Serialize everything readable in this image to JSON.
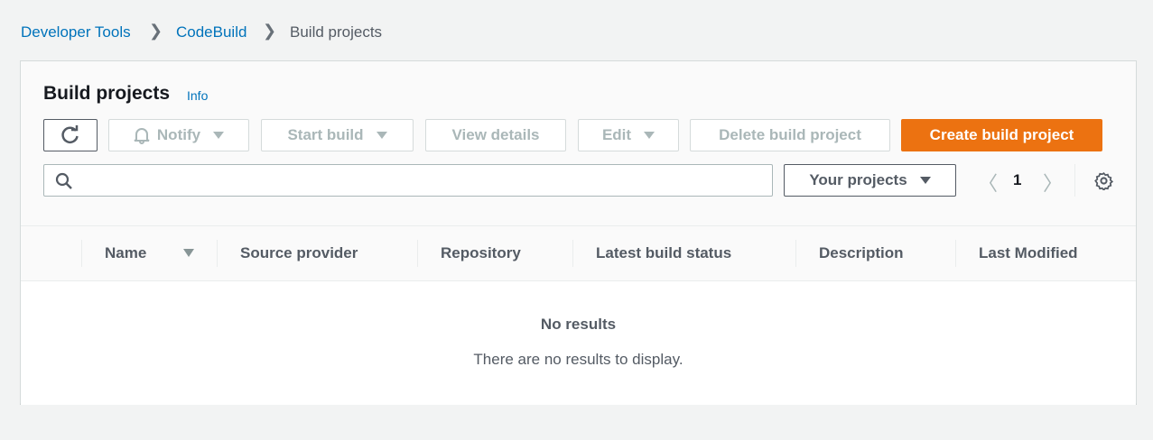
{
  "breadcrumb": [
    "Developer Tools",
    "CodeBuild",
    "Build projects"
  ],
  "title": "Build projects",
  "info": "Info",
  "toolbar": {
    "notify": "Notify",
    "start_build": "Start build",
    "view_details": "View details",
    "edit": "Edit",
    "delete": "Delete build project",
    "create": "Create build project"
  },
  "filter": {
    "placeholder": "",
    "scope": "Your projects"
  },
  "pagination": {
    "page": "1"
  },
  "columns": [
    "Name",
    "Source provider",
    "Repository",
    "Latest build status",
    "Description",
    "Last Modified"
  ],
  "empty": {
    "title": "No results",
    "message": "There are no results to display."
  },
  "colors": {
    "accent": "#ec7211",
    "link": "#0073bb"
  }
}
